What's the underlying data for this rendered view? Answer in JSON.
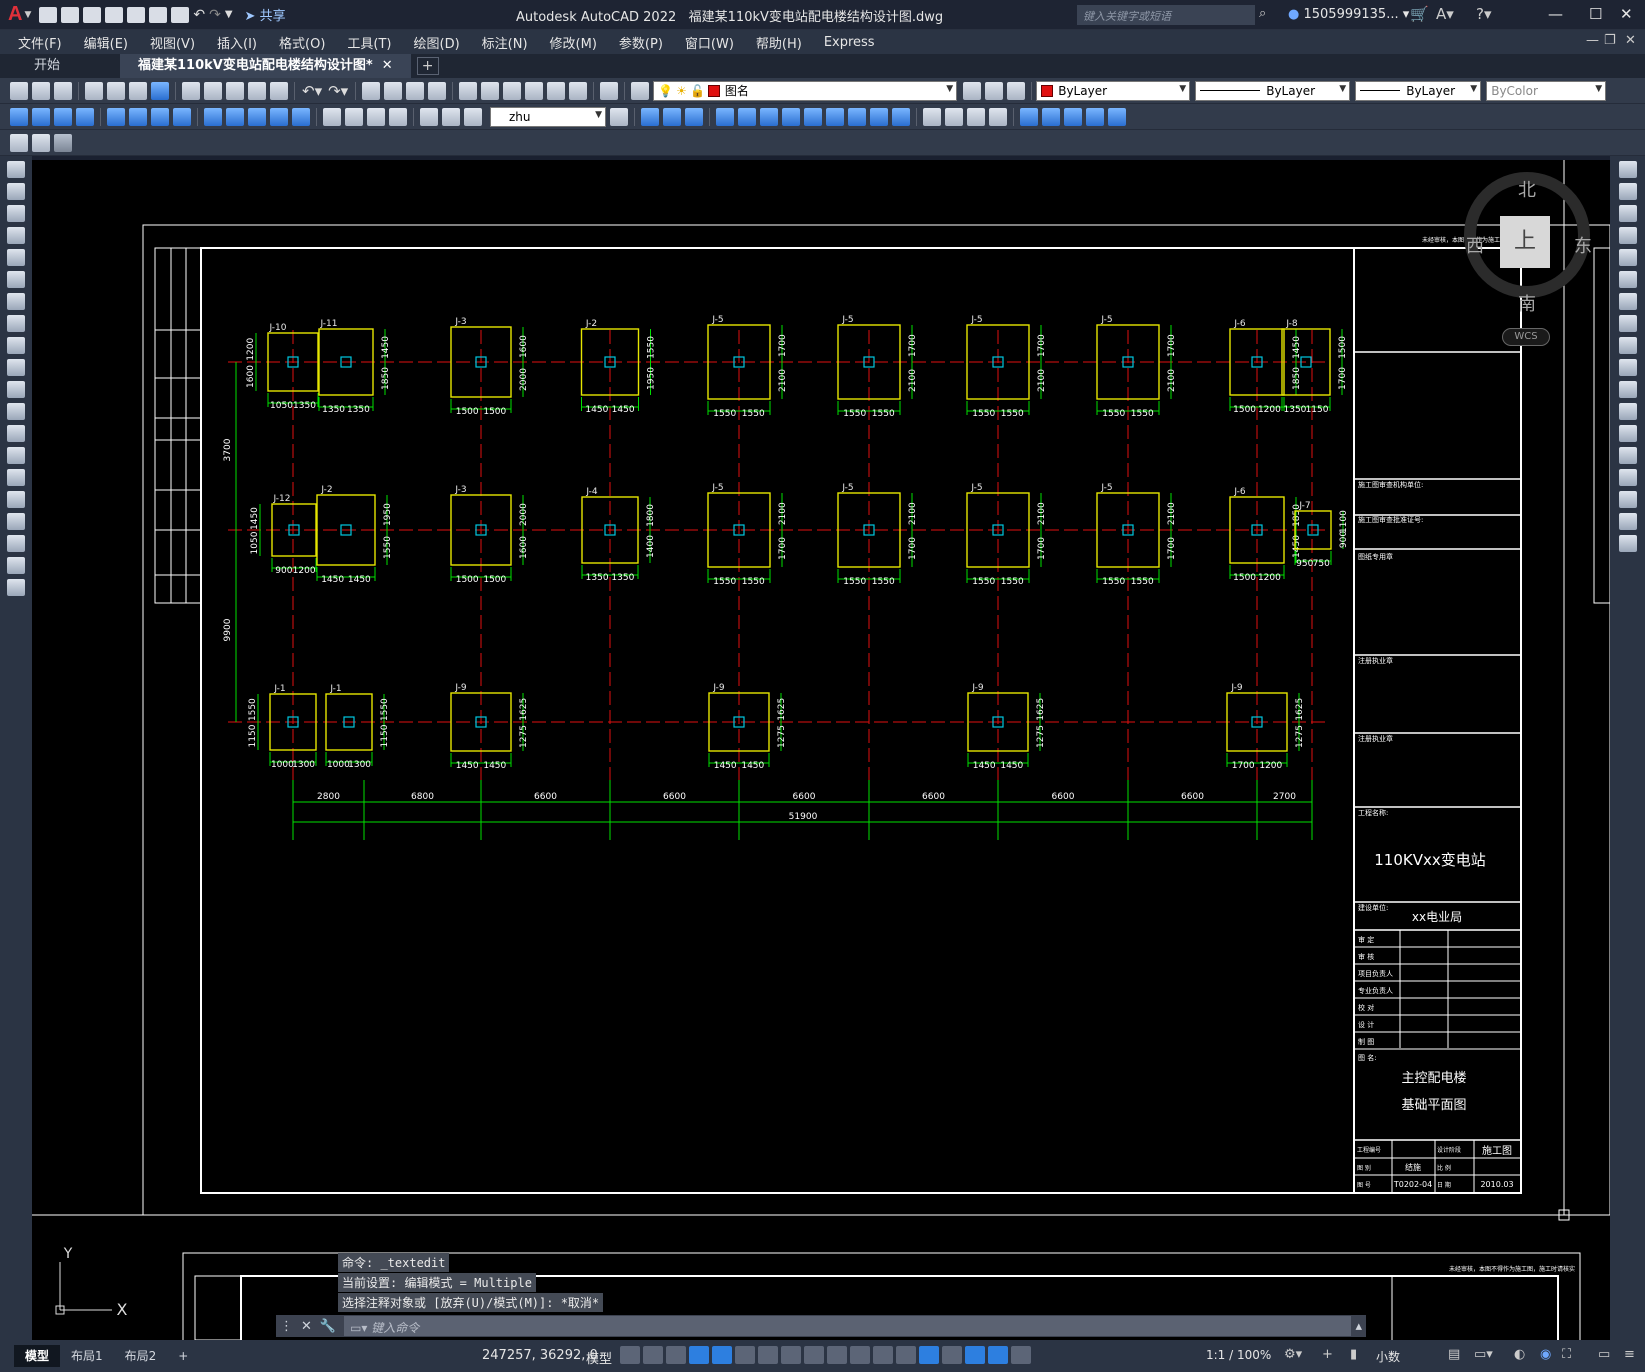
{
  "title": {
    "app": "Autodesk AutoCAD 2022",
    "file": "福建某110kV变电站配电楼结构设计图.dwg",
    "share": "共享",
    "search_placeholder": "键入关键字或短语",
    "user": "1505999135...",
    "logo": "A"
  },
  "menu": [
    "文件(F)",
    "编辑(E)",
    "视图(V)",
    "插入(I)",
    "格式(O)",
    "工具(T)",
    "绘图(D)",
    "标注(N)",
    "修改(M)",
    "参数(P)",
    "窗口(W)",
    "帮助(H)",
    "Express"
  ],
  "tabs": {
    "start": "开始",
    "doc": "福建某110kV变电站配电楼结构设计图*"
  },
  "toolbar": {
    "layer_name": "图名",
    "color": "ByLayer",
    "linetype": "ByLayer",
    "lineweight": "ByLayer",
    "plotstyle": "ByColor",
    "dimstyle": "zhu"
  },
  "compass": {
    "north": "北",
    "south": "南",
    "east": "东",
    "west": "西",
    "center": "上",
    "wcs": "WCS"
  },
  "drawing": {
    "foundations": {
      "row1": {
        "tags": [
          "J-10",
          "J-11",
          "J-3",
          "J-2",
          "J-5",
          "J-5",
          "J-5",
          "J-5",
          "J-6",
          "J-8"
        ],
        "bottom": [
          "1050",
          "1350",
          "1350",
          "1350",
          "1500",
          "1500",
          "1450",
          "1450",
          "1550",
          "1550",
          "1550",
          "1550",
          "1550",
          "1550",
          "1550",
          "1550",
          "1500",
          "1200",
          "1350",
          "1150"
        ],
        "side": [
          "1200",
          "1600",
          "1450",
          "1850",
          "1600",
          "2000",
          "1550",
          "1950",
          "1700",
          "2100",
          "1700",
          "2100",
          "1700",
          "2100",
          "1700",
          "2100",
          "1450",
          "1850",
          "1500",
          "1700"
        ],
        "left_dim": "3700"
      },
      "row2": {
        "tags": [
          "J-12",
          "J-2",
          "J-3",
          "J-4",
          "J-5",
          "J-5",
          "J-5",
          "J-5",
          "J-6",
          "J-7"
        ],
        "bottom": [
          "900",
          "1200",
          "1450",
          "1450",
          "1500",
          "1500",
          "1350",
          "1350",
          "1550",
          "1550",
          "1550",
          "1550",
          "1550",
          "1550",
          "1550",
          "1550",
          "1500",
          "1200",
          "950",
          "750"
        ],
        "side": [
          "1450",
          "1050",
          "1950",
          "1550",
          "2000",
          "1600",
          "1800",
          "1400",
          "2100",
          "1700",
          "2100",
          "1700",
          "2100",
          "1700",
          "2100",
          "1700",
          "1850",
          "1450",
          "1100",
          "900"
        ],
        "left_dim": "9900"
      },
      "row3": {
        "tags": [
          "J-1",
          "J-1",
          "J-9",
          "J-9",
          "J-9",
          "J-9"
        ],
        "bottom": [
          "1000",
          "1300",
          "1000",
          "1300",
          "1450",
          "1450",
          "1450",
          "1450",
          "1450",
          "1450",
          "1700",
          "1200"
        ],
        "side": [
          "1550",
          "1150",
          "1550",
          "1150",
          "1625",
          "1275",
          "1625",
          "1275",
          "1625",
          "1275",
          "1625",
          "1275"
        ]
      },
      "spans": [
        "2800",
        "6800",
        "6600",
        "6600",
        "6600",
        "6600",
        "6600",
        "6600",
        "2700"
      ],
      "total": "51900"
    },
    "titleblock": {
      "note": "未经审核，本图不得作为施工图，施工时请核实",
      "row_unit": "施工图审查机构单位:",
      "row_cert": "施工图审查批准证号:",
      "row_seal": "图纸专用章",
      "row_reg1": "注册执业章",
      "row_reg2": "注册执业章",
      "project_label": "工程名称:",
      "project": "110KVxx变电站",
      "client_label": "建设单位:",
      "client": "xx电业局",
      "roles": [
        "审  定",
        "审  核",
        "项目负责人",
        "专业负责人",
        "校  对",
        "设  计",
        "制  图"
      ],
      "drawing_label": "图  名:",
      "drawing1": "主控配电楼",
      "drawing2": "基础平面图",
      "stage_label": "设计阶段",
      "stage": "施工图",
      "proj_no_label": "工程编号",
      "discipline_label": "图  别",
      "discipline": "结施",
      "scale_label": "比  例",
      "no_label": "图  号",
      "no": "T0202-04",
      "date_label": "日  期",
      "date": "2010.03"
    },
    "ucs": {
      "x": "X",
      "y": "Y"
    }
  },
  "command": {
    "line1": "命令: _textedit",
    "line2": "当前设置: 编辑模式 = Multiple",
    "line3": "选择注释对象或 [放弃(U)/模式(M)]: *取消*",
    "placeholder": "键入命令"
  },
  "status": {
    "tabs": [
      "模型",
      "布局1",
      "布局2"
    ],
    "coords": "247257, 36292, 0",
    "space": "模型",
    "scale": "1:1 / 100%",
    "units": "小数"
  },
  "colors": {
    "canvas": "#000000",
    "footing": "#e6e600",
    "axis": "#e01010",
    "dim": "#00e000",
    "core": "#00c8e0",
    "frame": "#ffffff"
  }
}
